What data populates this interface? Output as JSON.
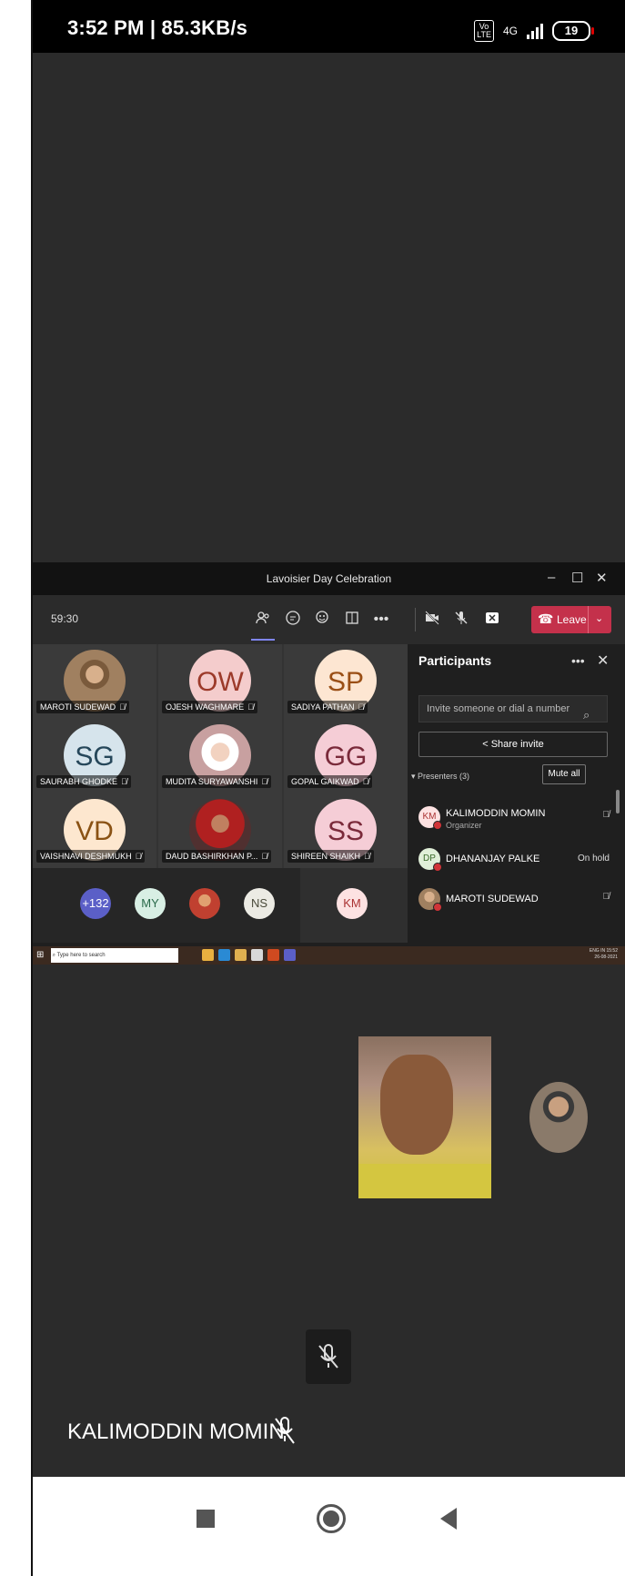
{
  "status_bar": {
    "time": "3:52 PM | 85.3KB/s",
    "volte": "Vo LTE",
    "network": "4G",
    "battery": "19"
  },
  "teams": {
    "window_title": "Lavoisier Day Celebration",
    "timer": "59:30",
    "leave_label": "Leave",
    "tiles": [
      {
        "initials": "",
        "name": "MAROTI SUDEWAD",
        "photo": true,
        "bg": "#a08060"
      },
      {
        "initials": "OW",
        "name": "OJESH WAGHMARE",
        "photo": false,
        "bg": "#f4cccc",
        "fg": "#9c3a2a"
      },
      {
        "initials": "SP",
        "name": "SADIYA PATHAN",
        "photo": false,
        "bg": "#fde6d2",
        "fg": "#9a4f16"
      },
      {
        "initials": "SG",
        "name": "SAURABH GHODKE",
        "photo": false,
        "bg": "#d6e4ec",
        "fg": "#26475a"
      },
      {
        "initials": "",
        "name": "MUDITA SURYAWANSHI",
        "photo": true,
        "bg": "#fff"
      },
      {
        "initials": "GG",
        "name": "GOPAL GAIKWAD",
        "photo": false,
        "bg": "#f5cdd6",
        "fg": "#7a2a3a"
      },
      {
        "initials": "VD",
        "name": "VAISHNAVI DESHMUKH",
        "photo": false,
        "bg": "#fde7cf",
        "fg": "#8a5214"
      },
      {
        "initials": "",
        "name": "DAUD BASHIRKHAN P...",
        "photo": true,
        "bg": "#b02020"
      },
      {
        "initials": "SS",
        "name": "SHIREEN SHAIKH",
        "photo": false,
        "bg": "#f5cdd6",
        "fg": "#7a2a3a"
      }
    ],
    "strip": [
      {
        "initials": "+132",
        "bg": "#5b5fc7",
        "fg": "#fff"
      },
      {
        "initials": "MY",
        "bg": "#d8efe4",
        "fg": "#2a6a4a"
      },
      {
        "initials": "",
        "bg": "#c04030",
        "fg": "#fff"
      },
      {
        "initials": "NS",
        "bg": "#ecebe4",
        "fg": "#4a4a3a"
      },
      {
        "initials": "KM",
        "bg": "#fde2e2",
        "fg": "#a33"
      }
    ],
    "participants": {
      "title": "Participants",
      "invite_placeholder": "Invite someone or dial a number",
      "share_invite": "Share invite",
      "presenters_label": "Presenters (3)",
      "mute_all": "Mute all",
      "rows": [
        {
          "initials": "KM",
          "name": "KALIMODDIN MOMIN",
          "sub": "Organizer",
          "right": "",
          "bg": "#fde2e2",
          "fg": "#a33"
        },
        {
          "initials": "DP",
          "name": "DHANANJAY PALKE",
          "sub": "",
          "right": "On hold",
          "bg": "#e0efd8",
          "fg": "#3a6a2a"
        },
        {
          "initials": "",
          "name": "MAROTI SUDEWAD",
          "sub": "",
          "right": "",
          "bg": "#a08060",
          "fg": "#fff"
        }
      ]
    }
  },
  "taskbar": {
    "search_placeholder": "Type here to search",
    "tray_time": "15:52",
    "tray_date": "26-08-2021",
    "tray_lang": "ENG IN"
  },
  "call": {
    "name": "KALIMODDIN MOMIN"
  }
}
